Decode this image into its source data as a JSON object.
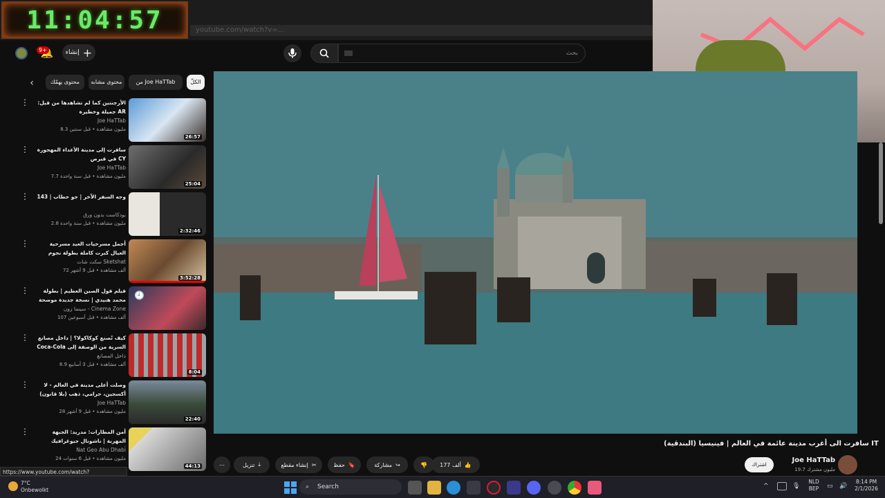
{
  "overlay": {
    "clock": "11:04:57",
    "url_ghost": "youtube.com/watch?v=..."
  },
  "header": {
    "notifications_badge": "9+",
    "create_label": "إنشاء",
    "search_placeholder": "بحث"
  },
  "chips": [
    "الكلّ",
    "من Joe HaTTab",
    "محتوى مشابه",
    "محتوى يهمّك"
  ],
  "related": [
    {
      "title": "الأرجنتين كما لم تشاهدها من قبل: جميلة وخطيرة AR",
      "channel": "Joe HaTTab",
      "meta": "8.3 مليون مشاهدة • قبل سنتين",
      "duration": "26:57"
    },
    {
      "title": "سافرت إلى مدينة الأعداء المهجورة في قبرص CY",
      "channel": "Joe HaTTab",
      "meta": "7.7 مليون مشاهدة • قبل سنة واحدة",
      "duration": "25:04"
    },
    {
      "title": "وجه السفر الآخر | جو حطاب | 143",
      "channel": "بودكاست بدون ورق",
      "meta": "2.8 مليون مشاهدة • قبل سنة واحدة",
      "duration": "2:32:46"
    },
    {
      "title": "أجمل مسرحيات العيد مسرحية العيال كبرت كاملة بطولة نجوم الزمن الجميل",
      "channel": "سكت شات Sketshat",
      "meta": "72 ألف مشاهدة • قبل 9 أشهر",
      "duration": "3:52:28"
    },
    {
      "title": "فيلم فول الصين العظيم | بطولة محمد هنيدي | نسخة جديدة موضحة HD كامل",
      "channel": "سينما زون - Cinema Zone",
      "meta": "107 ألف مشاهدة • قبل أسبوعين",
      "duration": ""
    },
    {
      "title": "كيف تُصنع كوكاكولا؟ | داخل مصانع Coca-Cola السرية من الوصفة إلى ...",
      "channel": "داخل المصانع",
      "meta": "8.9 ألف مشاهدة • قبل 3 أسابيع",
      "duration": "8:04"
    },
    {
      "title": "وصلت أعلى مدينة في العالم - لا أكسجين، حرامي، ذهب (بلا قانون) PE",
      "channel": "Joe HaTTab",
      "meta": "28 مليون مشاهدة • قبل 9 أشهر",
      "duration": "22:40"
    },
    {
      "title": "أمن المطارات: مدريد: الجبهة المهربة | ناشونال جيوغرافيك أبوظبي",
      "channel": "Nat Geo Abu Dhabi",
      "meta": "24 مليون مشاهدة • قبل 6 سنوات",
      "duration": "44:13"
    }
  ],
  "video": {
    "title": "سافرت الى أغرب مدينة عائمة في العالم | فينيسيا (البندقية) IT",
    "channel": "Joe HaTTab",
    "subscribers": "19.7 مليون مشترك",
    "subscribe_label": "اشتراك",
    "likes": "177 ألف",
    "share_label": "مشاركة",
    "save_label": "حفظ",
    "clip_label": "إنشاء مقطع",
    "download_label": "تنزيل"
  },
  "status_url": "https://www.youtube.com/watch?v=14H2ff5eLO8",
  "taskbar": {
    "temp": "7°C",
    "weather": "Onbewolkt",
    "search_label": "Search",
    "lang_top": "NLD",
    "lang_bottom": "BEP",
    "time": "8:14 PM",
    "date": "2/1/2026"
  },
  "colors": {
    "background": "#0f0f0f",
    "accent": "#cc0000",
    "clock_green": "#6ee86a"
  }
}
